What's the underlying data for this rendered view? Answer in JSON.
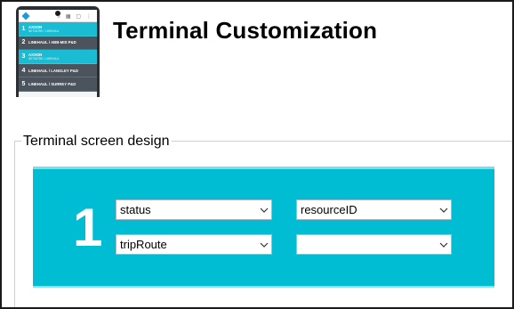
{
  "header": {
    "title": "Terminal Customization"
  },
  "phone_preview": {
    "toolbar_icons": "⌕ ▦ ▢ ⋮",
    "rows": [
      {
        "num": "1",
        "title": "AXSON",
        "sub": "NETWORK / LINEHAUL",
        "style": "teal"
      },
      {
        "num": "2",
        "title": "LINEHAUL / ABB-MIS P&D",
        "sub": "",
        "style": "dark"
      },
      {
        "num": "3",
        "title": "AXSON",
        "sub": "NETWORK / LINEHAUL",
        "style": "teal"
      },
      {
        "num": "4",
        "title": "LINEHAUL / LANGLEY P&D",
        "sub": "",
        "style": "dark"
      },
      {
        "num": "5",
        "title": "LINEHAUL / SURREY P&D",
        "sub": "",
        "style": "dark"
      }
    ]
  },
  "section": {
    "legend": "Terminal screen design"
  },
  "design": {
    "row_number": "1",
    "field_1": "status",
    "field_2": "resourceID",
    "field_3": "tripRoute",
    "field_4": ""
  },
  "colors": {
    "accent_teal": "#01bdd3",
    "phone_teal": "#19bcd2",
    "phone_dark": "#4b545c"
  }
}
